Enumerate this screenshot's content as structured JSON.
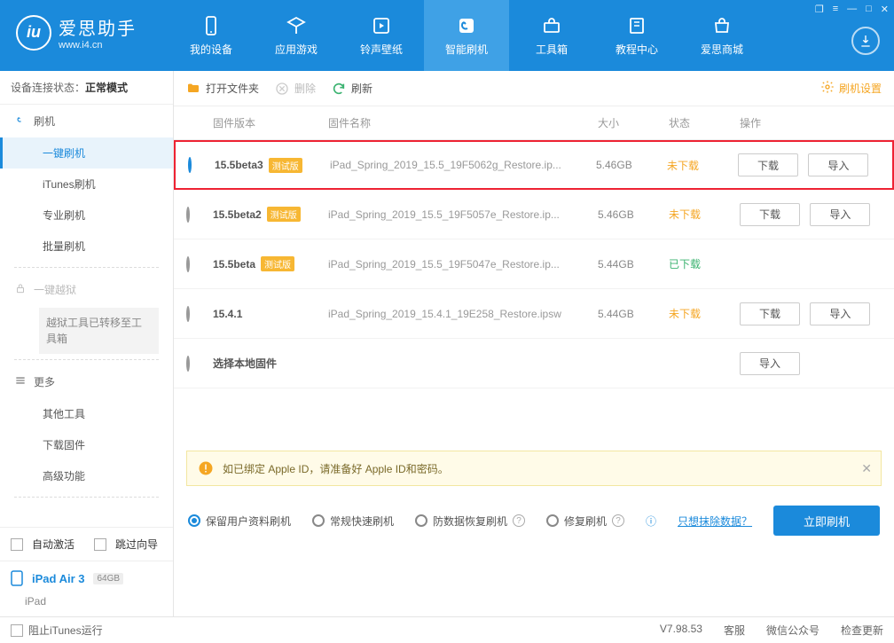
{
  "window_controls": [
    "❐",
    "≡",
    "—",
    "□",
    "✕"
  ],
  "app": {
    "name": "爱思助手",
    "url": "www.i4.cn"
  },
  "topnav": {
    "items": [
      {
        "label": "我的设备",
        "icon": "device"
      },
      {
        "label": "应用游戏",
        "icon": "apps"
      },
      {
        "label": "铃声壁纸",
        "icon": "music"
      },
      {
        "label": "智能刷机",
        "icon": "flash",
        "active": true
      },
      {
        "label": "工具箱",
        "icon": "toolbox"
      },
      {
        "label": "教程中心",
        "icon": "book"
      },
      {
        "label": "爱思商城",
        "icon": "shop"
      }
    ]
  },
  "sidebar": {
    "conn_label": "设备连接状态：",
    "conn_value": "正常模式",
    "groups": [
      {
        "label": "刷机",
        "icon": "flash",
        "items": [
          "一键刷机",
          "iTunes刷机",
          "专业刷机",
          "批量刷机"
        ],
        "active_index": 0
      },
      {
        "label": "一键越狱",
        "icon": "lock",
        "disabled": true,
        "note": "越狱工具已转移至工具箱"
      },
      {
        "label": "更多",
        "icon": "more",
        "items": [
          "其他工具",
          "下载固件",
          "高级功能"
        ]
      }
    ],
    "auto_activate": "自动激活",
    "skip_guide": "跳过向导",
    "device": {
      "name": "iPad Air 3",
      "cap": "64GB",
      "sub": "iPad"
    }
  },
  "toolbar": {
    "open": "打开文件夹",
    "delete": "删除",
    "refresh": "刷新",
    "settings": "刷机设置"
  },
  "table": {
    "headers": {
      "version": "固件版本",
      "name": "固件名称",
      "size": "大小",
      "status": "状态",
      "action": "操作"
    },
    "btn_download": "下载",
    "btn_import": "导入",
    "local_label": "选择本地固件",
    "rows": [
      {
        "version": "15.5beta3",
        "beta": true,
        "name": "iPad_Spring_2019_15.5_19F5062g_Restore.ip...",
        "size": "5.46GB",
        "status": "未下载",
        "st": "nodl",
        "selected": true,
        "highlight": true,
        "dl": true,
        "imp": true
      },
      {
        "version": "15.5beta2",
        "beta": true,
        "name": "iPad_Spring_2019_15.5_19F5057e_Restore.ip...",
        "size": "5.46GB",
        "status": "未下载",
        "st": "nodl",
        "dl": true,
        "imp": true
      },
      {
        "version": "15.5beta",
        "beta": true,
        "name": "iPad_Spring_2019_15.5_19F5047e_Restore.ip...",
        "size": "5.44GB",
        "status": "已下载",
        "st": "dl"
      },
      {
        "version": "15.4.1",
        "beta": false,
        "name": "iPad_Spring_2019_15.4.1_19E258_Restore.ipsw",
        "size": "5.44GB",
        "status": "未下载",
        "st": "nodl",
        "dl": true,
        "imp": true
      }
    ]
  },
  "notice": "如已绑定 Apple ID，请准备好 Apple ID和密码。",
  "modes": {
    "opts": [
      {
        "label": "保留用户资料刷机",
        "sel": true
      },
      {
        "label": "常规快速刷机"
      },
      {
        "label": "防数据恢复刷机",
        "q": true
      },
      {
        "label": "修复刷机",
        "q": true
      }
    ],
    "info_icon": "ⓘ",
    "erase": "只想抹除数据？",
    "flash": "立即刷机"
  },
  "statusbar": {
    "block_itunes": "阻止iTunes运行",
    "version": "V7.98.53",
    "links": [
      "客服",
      "微信公众号",
      "检查更新"
    ]
  }
}
